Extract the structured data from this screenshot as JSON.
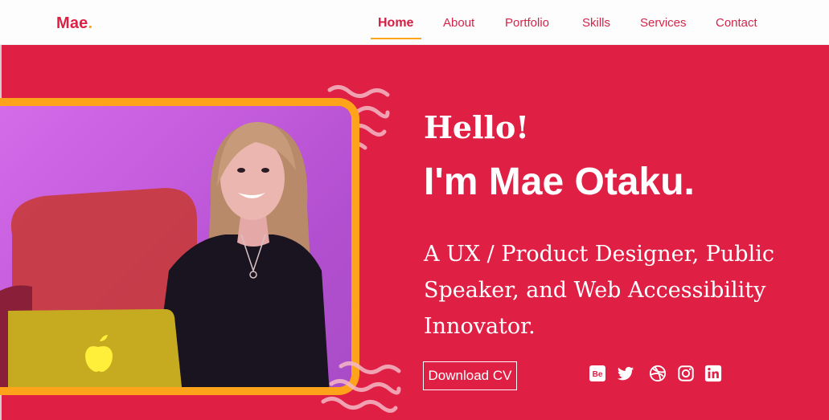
{
  "nav": {
    "logo_text": "Mae",
    "logo_dot": ".",
    "items": [
      {
        "label": "Home"
      },
      {
        "label": "About"
      },
      {
        "label": "Portfolio"
      },
      {
        "label": "Skills"
      },
      {
        "label": "Services"
      },
      {
        "label": "Contact"
      }
    ],
    "active_item": "Home"
  },
  "hero": {
    "greeting": "Hello!",
    "name": "I'm Mae Otaku.",
    "tagline": "A UX / Product Designer, Public Speaker, and Web Accessibility Innovator.",
    "cv_button": "Download CV",
    "social_icons": [
      "behance-icon",
      "twitter-icon",
      "dribbble-icon",
      "instagram-icon",
      "linkedin-icon"
    ],
    "behance_text": "Be"
  },
  "colors": {
    "brand_red": "#e01f45",
    "accent_orange": "#ffa31a",
    "nav_bg": "#fdfdfd"
  }
}
